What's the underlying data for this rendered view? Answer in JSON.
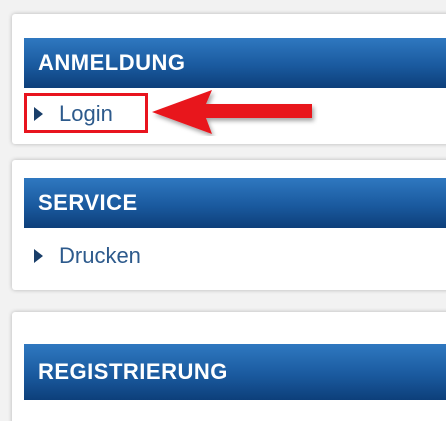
{
  "sections": [
    {
      "title": "ANMELDUNG",
      "link": "Login"
    },
    {
      "title": "SERVICE",
      "link": "Drucken"
    },
    {
      "title": "REGISTRIERUNG",
      "link": ""
    }
  ],
  "colors": {
    "header_gradient_top": "#2f78c0",
    "header_gradient_bottom": "#0d3f7a",
    "link_text": "#2d5a8c",
    "annotation_red": "#e8141e"
  },
  "icons": {
    "link_bullet": "triangle-right-icon",
    "annotation": "red-arrow-left-icon"
  }
}
